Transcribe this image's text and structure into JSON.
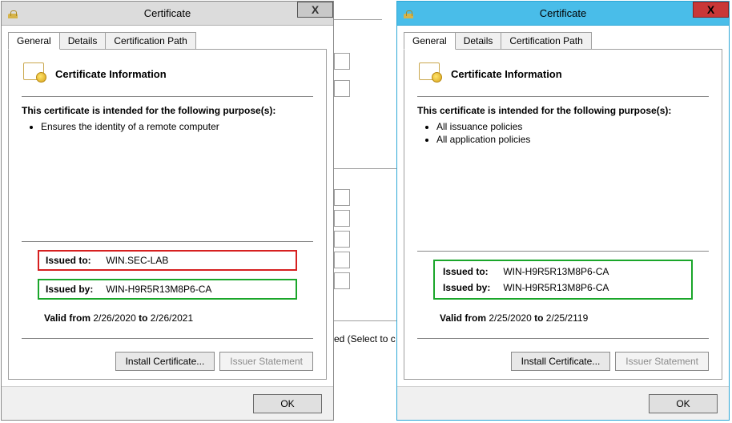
{
  "bg": {
    "select_text": "ed (Select to c"
  },
  "left": {
    "title": "Certificate",
    "close": "X",
    "tabs": {
      "general": "General",
      "details": "Details",
      "certpath": "Certification Path"
    },
    "cert_info_heading": "Certificate Information",
    "purpose_heading": "This certificate is intended for the following purpose(s):",
    "purposes": [
      "Ensures the identity of a remote computer"
    ],
    "issued_to_label": "Issued to:",
    "issued_to_value": "WIN.SEC-LAB",
    "issued_by_label": "Issued by:",
    "issued_by_value": "WIN-H9R5R13M8P6-CA",
    "valid_from_label": "Valid from",
    "valid_from_value": "2/26/2020",
    "valid_to_label": "to",
    "valid_to_value": "2/26/2021",
    "install_btn": "Install Certificate...",
    "issuer_btn": "Issuer Statement",
    "ok": "OK"
  },
  "right": {
    "title": "Certificate",
    "close": "X",
    "tabs": {
      "general": "General",
      "details": "Details",
      "certpath": "Certification Path"
    },
    "cert_info_heading": "Certificate Information",
    "purpose_heading": "This certificate is intended for the following purpose(s):",
    "purposes": [
      "All issuance policies",
      "All application policies"
    ],
    "issued_to_label": "Issued to:",
    "issued_to_value": "WIN-H9R5R13M8P6-CA",
    "issued_by_label": "Issued by:",
    "issued_by_value": "WIN-H9R5R13M8P6-CA",
    "valid_from_label": "Valid from",
    "valid_from_value": "2/25/2020",
    "valid_to_label": "to",
    "valid_to_value": "2/25/2119",
    "install_btn": "Install Certificate...",
    "issuer_btn": "Issuer Statement",
    "ok": "OK"
  }
}
